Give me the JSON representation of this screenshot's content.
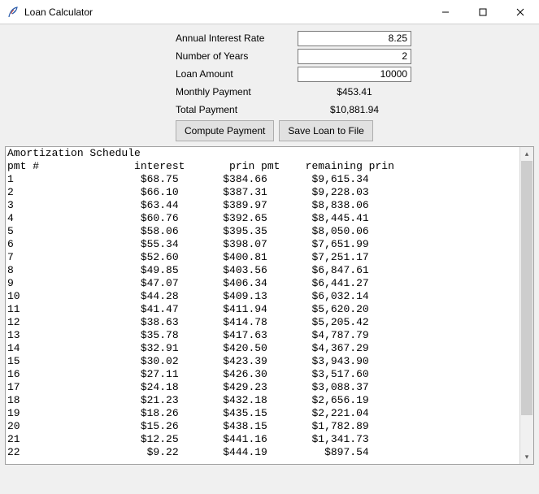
{
  "window": {
    "title": "Loan Calculator"
  },
  "labels": {
    "annual_rate": "Annual Interest Rate",
    "years": "Number of Years",
    "loan_amount": "Loan Amount",
    "monthly_payment": "Monthly Payment",
    "total_payment": "Total Payment"
  },
  "inputs": {
    "annual_rate": "8.25",
    "years": "2",
    "loan_amount": "10000"
  },
  "outputs": {
    "monthly_payment": "$453.41",
    "total_payment": "$10,881.94"
  },
  "buttons": {
    "compute": "Compute Payment",
    "save": "Save Loan to File"
  },
  "schedule": {
    "title": "Amortization Schedule",
    "headers": {
      "pmt": "pmt #",
      "interest": "interest",
      "prin": "prin pmt",
      "remaining": "remaining prin"
    },
    "rows": [
      {
        "n": "1",
        "interest": "$68.75",
        "prin": "$384.66",
        "remaining": "$9,615.34"
      },
      {
        "n": "2",
        "interest": "$66.10",
        "prin": "$387.31",
        "remaining": "$9,228.03"
      },
      {
        "n": "3",
        "interest": "$63.44",
        "prin": "$389.97",
        "remaining": "$8,838.06"
      },
      {
        "n": "4",
        "interest": "$60.76",
        "prin": "$392.65",
        "remaining": "$8,445.41"
      },
      {
        "n": "5",
        "interest": "$58.06",
        "prin": "$395.35",
        "remaining": "$8,050.06"
      },
      {
        "n": "6",
        "interest": "$55.34",
        "prin": "$398.07",
        "remaining": "$7,651.99"
      },
      {
        "n": "7",
        "interest": "$52.60",
        "prin": "$400.81",
        "remaining": "$7,251.17"
      },
      {
        "n": "8",
        "interest": "$49.85",
        "prin": "$403.56",
        "remaining": "$6,847.61"
      },
      {
        "n": "9",
        "interest": "$47.07",
        "prin": "$406.34",
        "remaining": "$6,441.27"
      },
      {
        "n": "10",
        "interest": "$44.28",
        "prin": "$409.13",
        "remaining": "$6,032.14"
      },
      {
        "n": "11",
        "interest": "$41.47",
        "prin": "$411.94",
        "remaining": "$5,620.20"
      },
      {
        "n": "12",
        "interest": "$38.63",
        "prin": "$414.78",
        "remaining": "$5,205.42"
      },
      {
        "n": "13",
        "interest": "$35.78",
        "prin": "$417.63",
        "remaining": "$4,787.79"
      },
      {
        "n": "14",
        "interest": "$32.91",
        "prin": "$420.50",
        "remaining": "$4,367.29"
      },
      {
        "n": "15",
        "interest": "$30.02",
        "prin": "$423.39",
        "remaining": "$3,943.90"
      },
      {
        "n": "16",
        "interest": "$27.11",
        "prin": "$426.30",
        "remaining": "$3,517.60"
      },
      {
        "n": "17",
        "interest": "$24.18",
        "prin": "$429.23",
        "remaining": "$3,088.37"
      },
      {
        "n": "18",
        "interest": "$21.23",
        "prin": "$432.18",
        "remaining": "$2,656.19"
      },
      {
        "n": "19",
        "interest": "$18.26",
        "prin": "$435.15",
        "remaining": "$2,221.04"
      },
      {
        "n": "20",
        "interest": "$15.26",
        "prin": "$438.15",
        "remaining": "$1,782.89"
      },
      {
        "n": "21",
        "interest": "$12.25",
        "prin": "$441.16",
        "remaining": "$1,341.73"
      },
      {
        "n": "22",
        "interest": "$9.22",
        "prin": "$444.19",
        "remaining": "$897.54"
      }
    ]
  }
}
